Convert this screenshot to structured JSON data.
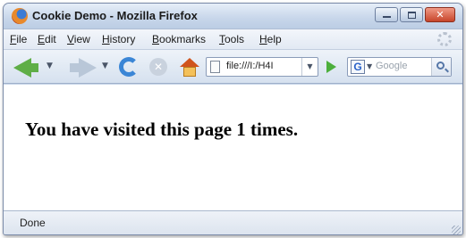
{
  "window": {
    "title": "Cookie Demo - Mozilla Firefox",
    "min_glyph": "",
    "max_glyph": "",
    "close_glyph": "✕"
  },
  "menu": {
    "items": [
      {
        "label": "File"
      },
      {
        "label": "Edit"
      },
      {
        "label": "View"
      },
      {
        "label": "History"
      },
      {
        "label": "Bookmarks"
      },
      {
        "label": "Tools"
      },
      {
        "label": "Help"
      }
    ]
  },
  "toolbar": {
    "url": "file:///I:/H4I",
    "dropdown_glyph": "▼",
    "search_engine_glyph": "G",
    "search_placeholder": "Google",
    "stop_glyph": "✕"
  },
  "page": {
    "heading": "You have visited this page 1 times."
  },
  "status": {
    "text": "Done"
  },
  "colors": {
    "back_arrow": "#5fae47",
    "reload": "#3b86d6",
    "go": "#4caf3c",
    "close_button": "#c7452b"
  },
  "icons": [
    "firefox-logo-icon",
    "back-arrow-icon",
    "forward-arrow-icon",
    "reload-icon",
    "stop-icon",
    "home-icon",
    "page-icon",
    "go-icon",
    "google-icon",
    "search-icon",
    "throbber-icon",
    "resize-grip-icon"
  ]
}
